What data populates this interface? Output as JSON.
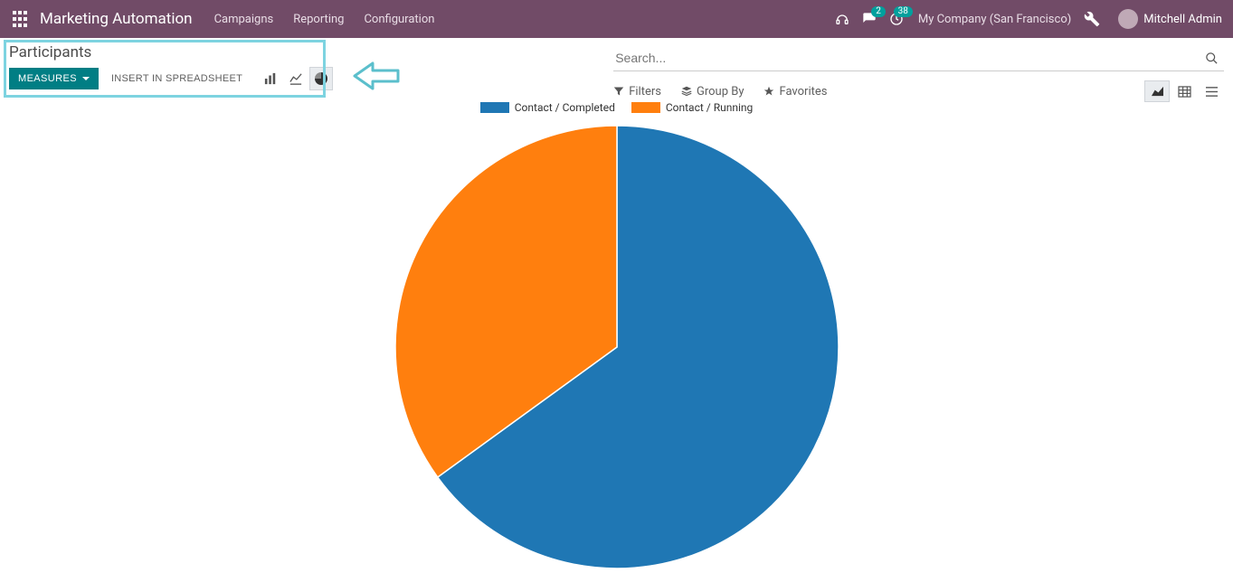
{
  "navbar": {
    "brand": "Marketing Automation",
    "menu": [
      "Campaigns",
      "Reporting",
      "Configuration"
    ],
    "chat_badge": "2",
    "clock_badge": "38",
    "company": "My Company (San Francisco)",
    "user": "Mitchell Admin"
  },
  "breadcrumb": "Participants",
  "toolbar": {
    "measures_label": "MEASURES",
    "spreadsheet_label": "INSERT IN SPREADSHEET"
  },
  "search": {
    "placeholder": "Search..."
  },
  "filters": {
    "filters_label": "Filters",
    "groupby_label": "Group By",
    "favorites_label": "Favorites"
  },
  "colors": {
    "series0": "#1f77b4",
    "series1": "#ff7f0e"
  },
  "chart_data": {
    "type": "pie",
    "title": "",
    "series": [
      {
        "name": "Contact / Completed",
        "value": 65
      },
      {
        "name": "Contact / Running",
        "value": 35
      }
    ]
  }
}
